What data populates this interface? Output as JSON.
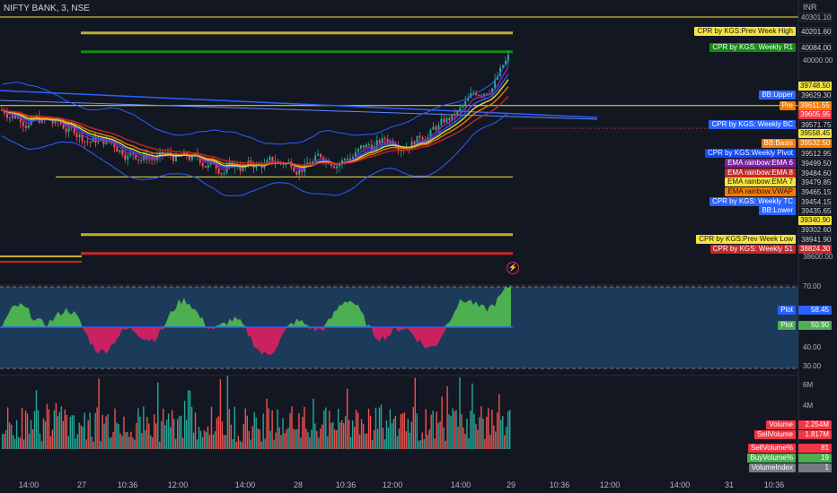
{
  "header": {
    "symbol": "NIFTY BANK, 3, NSE",
    "currency": "INR"
  },
  "price_axis": [
    "40000.00",
    "38600.00"
  ],
  "osc_axis": [
    "70.00",
    "40.00",
    "30.00"
  ],
  "vol_axis": [
    "6M",
    "4M"
  ],
  "time_axis": [
    "14:00",
    "27",
    "10:36",
    "12:00",
    "14:00",
    "28",
    "10:36",
    "12:00",
    "14:00",
    "29",
    "10:36",
    "12:00",
    "14:00",
    "31",
    "10:36"
  ],
  "levels": [
    {
      "price": "40301.10",
      "bg": "#131722",
      "fg": "#b2b5be",
      "name": "",
      "nbg": "",
      "nfg": "",
      "line": "#f7e53c"
    },
    {
      "price": "40201.60",
      "bg": "#131722",
      "fg": "#d1d4dc",
      "name": "CPR by KGS:Prev Week High",
      "nbg": "#f7e53c",
      "nfg": "#131722",
      "line": "#bfb033"
    },
    {
      "price": "40084.00",
      "bg": "#131722",
      "fg": "#d1d4dc",
      "name": "CPR by KGS: Weekly R1",
      "nbg": "#138a13",
      "nfg": "#ffffff",
      "line": "#138a13"
    },
    {
      "price": "39748.50",
      "bg": "#f7e53c",
      "fg": "#131722",
      "name": "",
      "nbg": "",
      "nfg": "",
      "line": "#f7e53c"
    },
    {
      "price": "39629.30",
      "bg": "#131722",
      "fg": "#d1d4dc",
      "name": "BB:Upper",
      "nbg": "#2962ff",
      "nfg": "#ffffff",
      "line": ""
    },
    {
      "price": "39611.55",
      "bg": "#f57c00",
      "fg": "#ffffff",
      "name": "Pre",
      "nbg": "#f57c00",
      "nfg": "#ffffff",
      "line": ""
    },
    {
      "price": "39605.95",
      "bg": "#f23645",
      "fg": "#ffffff",
      "name": "",
      "nbg": "",
      "nfg": "",
      "line": ""
    },
    {
      "price": "39571.75",
      "bg": "#131722",
      "fg": "#d1d4dc",
      "name": "CPR by KGS: Weekly BC",
      "nbg": "#2962ff",
      "nfg": "#ffffff",
      "line": ""
    },
    {
      "price": "39558.45",
      "bg": "#f7e53c",
      "fg": "#131722",
      "name": "",
      "nbg": "",
      "nfg": "",
      "line": ""
    },
    {
      "price": "39532.50",
      "bg": "#f57c00",
      "fg": "#ffffff",
      "name": "BB:Basis",
      "nbg": "#f57c00",
      "nfg": "#ffffff",
      "line": ""
    },
    {
      "price": "39512.95",
      "bg": "#131722",
      "fg": "#d1d4dc",
      "name": "CPR by KGS:Weekly Pivot",
      "nbg": "#0d47ff",
      "nfg": "#ffffff",
      "line": ""
    },
    {
      "price": "39499.50",
      "bg": "#131722",
      "fg": "#d1d4dc",
      "name": "EMA rainbow:EMA 6",
      "nbg": "#7b1fa2",
      "nfg": "#ffffff",
      "line": ""
    },
    {
      "price": "39484.60",
      "bg": "#131722",
      "fg": "#d1d4dc",
      "name": "EMA rainbow:EMA 8",
      "nbg": "#c62828",
      "nfg": "#ffffff",
      "line": ""
    },
    {
      "price": "39479.85",
      "bg": "#131722",
      "fg": "#d1d4dc",
      "name": "EMA rainbow:EMA 7",
      "nbg": "#f7e53c",
      "nfg": "#131722",
      "line": ""
    },
    {
      "price": "39465.15",
      "bg": "#131722",
      "fg": "#d1d4dc",
      "name": "EMA rainbow:VWAP",
      "nbg": "#f57c00",
      "nfg": "#131722",
      "line": ""
    },
    {
      "price": "39454.15",
      "bg": "#131722",
      "fg": "#d1d4dc",
      "name": "CPR by KGS: Weekly TC",
      "nbg": "#2962ff",
      "nfg": "#ffffff",
      "line": ""
    },
    {
      "price": "39435.65",
      "bg": "#131722",
      "fg": "#d1d4dc",
      "name": "BB:Lower",
      "nbg": "#2962ff",
      "nfg": "#ffffff",
      "line": ""
    },
    {
      "price": "39340.90",
      "bg": "#f7e53c",
      "fg": "#131722",
      "name": "",
      "nbg": "",
      "nfg": "",
      "line": ""
    },
    {
      "price": "39302.60",
      "bg": "#131722",
      "fg": "#d1d4dc",
      "name": "",
      "nbg": "",
      "nfg": "",
      "line": ""
    },
    {
      "price": "38941.90",
      "bg": "#131722",
      "fg": "#d1d4dc",
      "name": "CPR by KGS:Prev Week Low",
      "nbg": "#f7e53c",
      "nfg": "#131722",
      "line": ""
    },
    {
      "price": "38824.30",
      "bg": "#c62828",
      "fg": "#ffffff",
      "name": "CPR by KGS: Weekly S1",
      "nbg": "#c62828",
      "nfg": "#ffffff",
      "line": ""
    }
  ],
  "osc_labels": [
    {
      "name": "Plot",
      "value": "58.45",
      "bg": "#2962ff"
    },
    {
      "name": "Plot",
      "value": "50.90",
      "bg": "#4caf50"
    }
  ],
  "vol_labels": [
    {
      "name": "Volume",
      "value": "2.254M",
      "bg": "#f23645"
    },
    {
      "name": "SellVolume",
      "value": "1.817M",
      "bg": "#f23645"
    },
    {
      "name": "SellVolume%",
      "value": "81",
      "bg": "#f23645"
    },
    {
      "name": "BuyVolume%",
      "value": "19",
      "bg": "#4caf50"
    },
    {
      "name": "VolumeIndex",
      "value": "1",
      "bg": "#787b86"
    }
  ],
  "colors": {
    "bg": "#131722",
    "up": "#26a69a",
    "down": "#ef5350",
    "osc_bg": "#1c3a5a",
    "osc_green": "#4caf50",
    "osc_red": "#e91e63"
  }
}
